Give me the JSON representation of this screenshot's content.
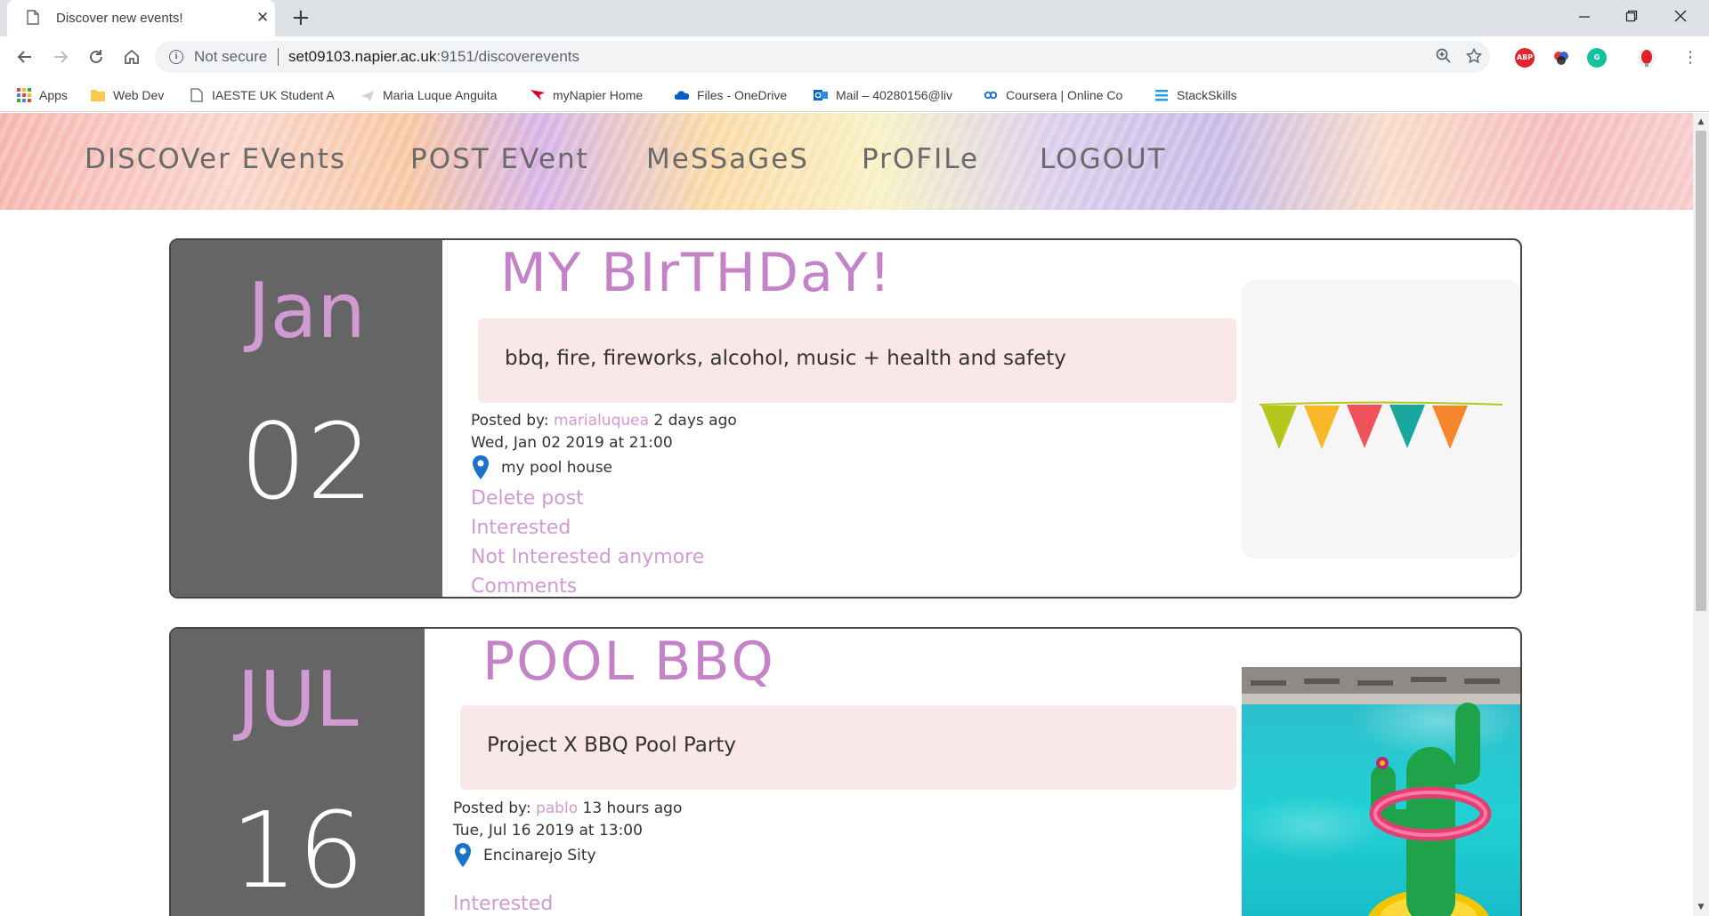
{
  "browser": {
    "tab_title": "Discover new events!",
    "tab_close": "✕",
    "new_tab": "+",
    "not_secure": "Not secure",
    "url_host": "set09103.napier.ac.uk",
    "url_path": ":9151/discoverevents",
    "extensions": [
      "ABP",
      "",
      "G",
      ""
    ],
    "bookmarks": [
      {
        "label": "Apps",
        "icon": "apps-grid-icon"
      },
      {
        "label": "Web Dev",
        "icon": "folder-icon"
      },
      {
        "label": "IAESTE UK Student A",
        "icon": "page-icon"
      },
      {
        "label": "Maria Luque Anguita",
        "icon": "plane-icon"
      },
      {
        "label": "myNapier Home",
        "icon": "napier-flag-icon"
      },
      {
        "label": "Files - OneDrive",
        "icon": "onedrive-cloud-icon"
      },
      {
        "label": "Mail – 40280156@liv",
        "icon": "outlook-icon"
      },
      {
        "label": "Coursera | Online Co",
        "icon": "coursera-icon"
      },
      {
        "label": "StackSkills",
        "icon": "stack-icon"
      }
    ]
  },
  "nav": {
    "discover": "DISCOVer EVents",
    "post": "POST EVent",
    "messages": "MeSSaGeS",
    "profile": "PrOFILe",
    "logout": "LOGOUT"
  },
  "events": [
    {
      "month": "Jan",
      "day": "02",
      "title": "MY BIrTHDaY!",
      "description": "bbq, fire, fireworks, alcohol, music + health and safety",
      "posted_by_label": "Posted by: ",
      "poster": "marialuquea",
      "posted_ago": " 2 days ago",
      "datetime": "Wed, Jan 02 2019 at 21:00",
      "location": "my pool house",
      "actions": [
        "Delete post",
        "Interested",
        "Not Interested anymore",
        "Comments"
      ],
      "image": "bunting-flags",
      "bunting_colors": [
        "#b5c71c",
        "#f9b82a",
        "#f0525a",
        "#1aa7a0",
        "#f6862b"
      ]
    },
    {
      "month": "JUL",
      "day": "16",
      "title": "POOL BBQ",
      "description": "Project X BBQ Pool Party",
      "posted_by_label": "Posted by: ",
      "poster": "pablo",
      "posted_ago": " 13 hours ago",
      "datetime": "Tue, Jul 16 2019 at 13:00",
      "location": "Encinarejo Sity",
      "actions": [
        "Interested"
      ],
      "image": "pool-cactus-photo"
    }
  ],
  "colors": {
    "accent_pink": "#d29ad3",
    "title_purple": "#c482c9",
    "date_box": "#656565",
    "desc_bg": "#fae7e8",
    "pin_blue": "#1a73c8"
  }
}
